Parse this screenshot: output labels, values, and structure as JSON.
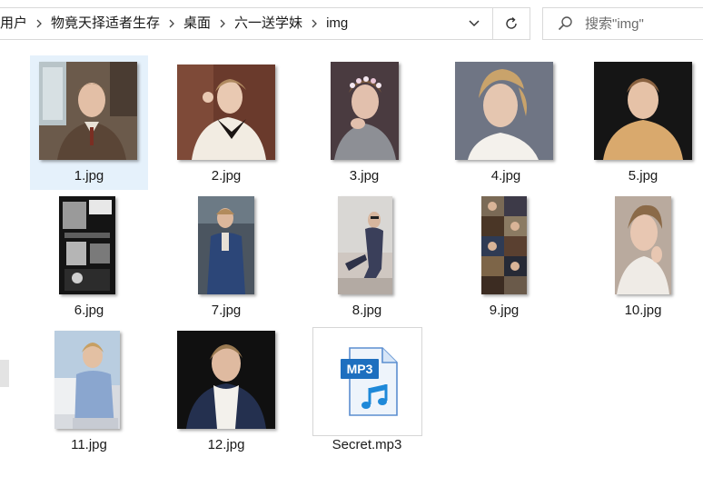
{
  "address_bar": {
    "crumbs": [
      "用户",
      "物竟天择适者生存",
      "桌面",
      "六一送学妹",
      "img"
    ]
  },
  "search": {
    "placeholder": "搜索\"img\""
  },
  "files": [
    {
      "name": "1.jpg",
      "selected": true
    },
    {
      "name": "2.jpg"
    },
    {
      "name": "3.jpg"
    },
    {
      "name": "4.jpg"
    },
    {
      "name": "5.jpg"
    },
    {
      "name": "6.jpg"
    },
    {
      "name": "7.jpg"
    },
    {
      "name": "8.jpg"
    },
    {
      "name": "9.jpg"
    },
    {
      "name": "10.jpg"
    },
    {
      "name": "11.jpg"
    },
    {
      "name": "12.jpg"
    },
    {
      "name": "Secret.mp3",
      "icon": "mp3-file-icon",
      "badge": "MP3"
    }
  ],
  "icons": {
    "separator": "chevron-right-icon",
    "history": "chevron-down-icon",
    "refresh": "refresh-icon",
    "search": "search-icon"
  },
  "colors": {
    "selection": "#e5f1fb",
    "mp3_badge": "#1e6fbf"
  }
}
